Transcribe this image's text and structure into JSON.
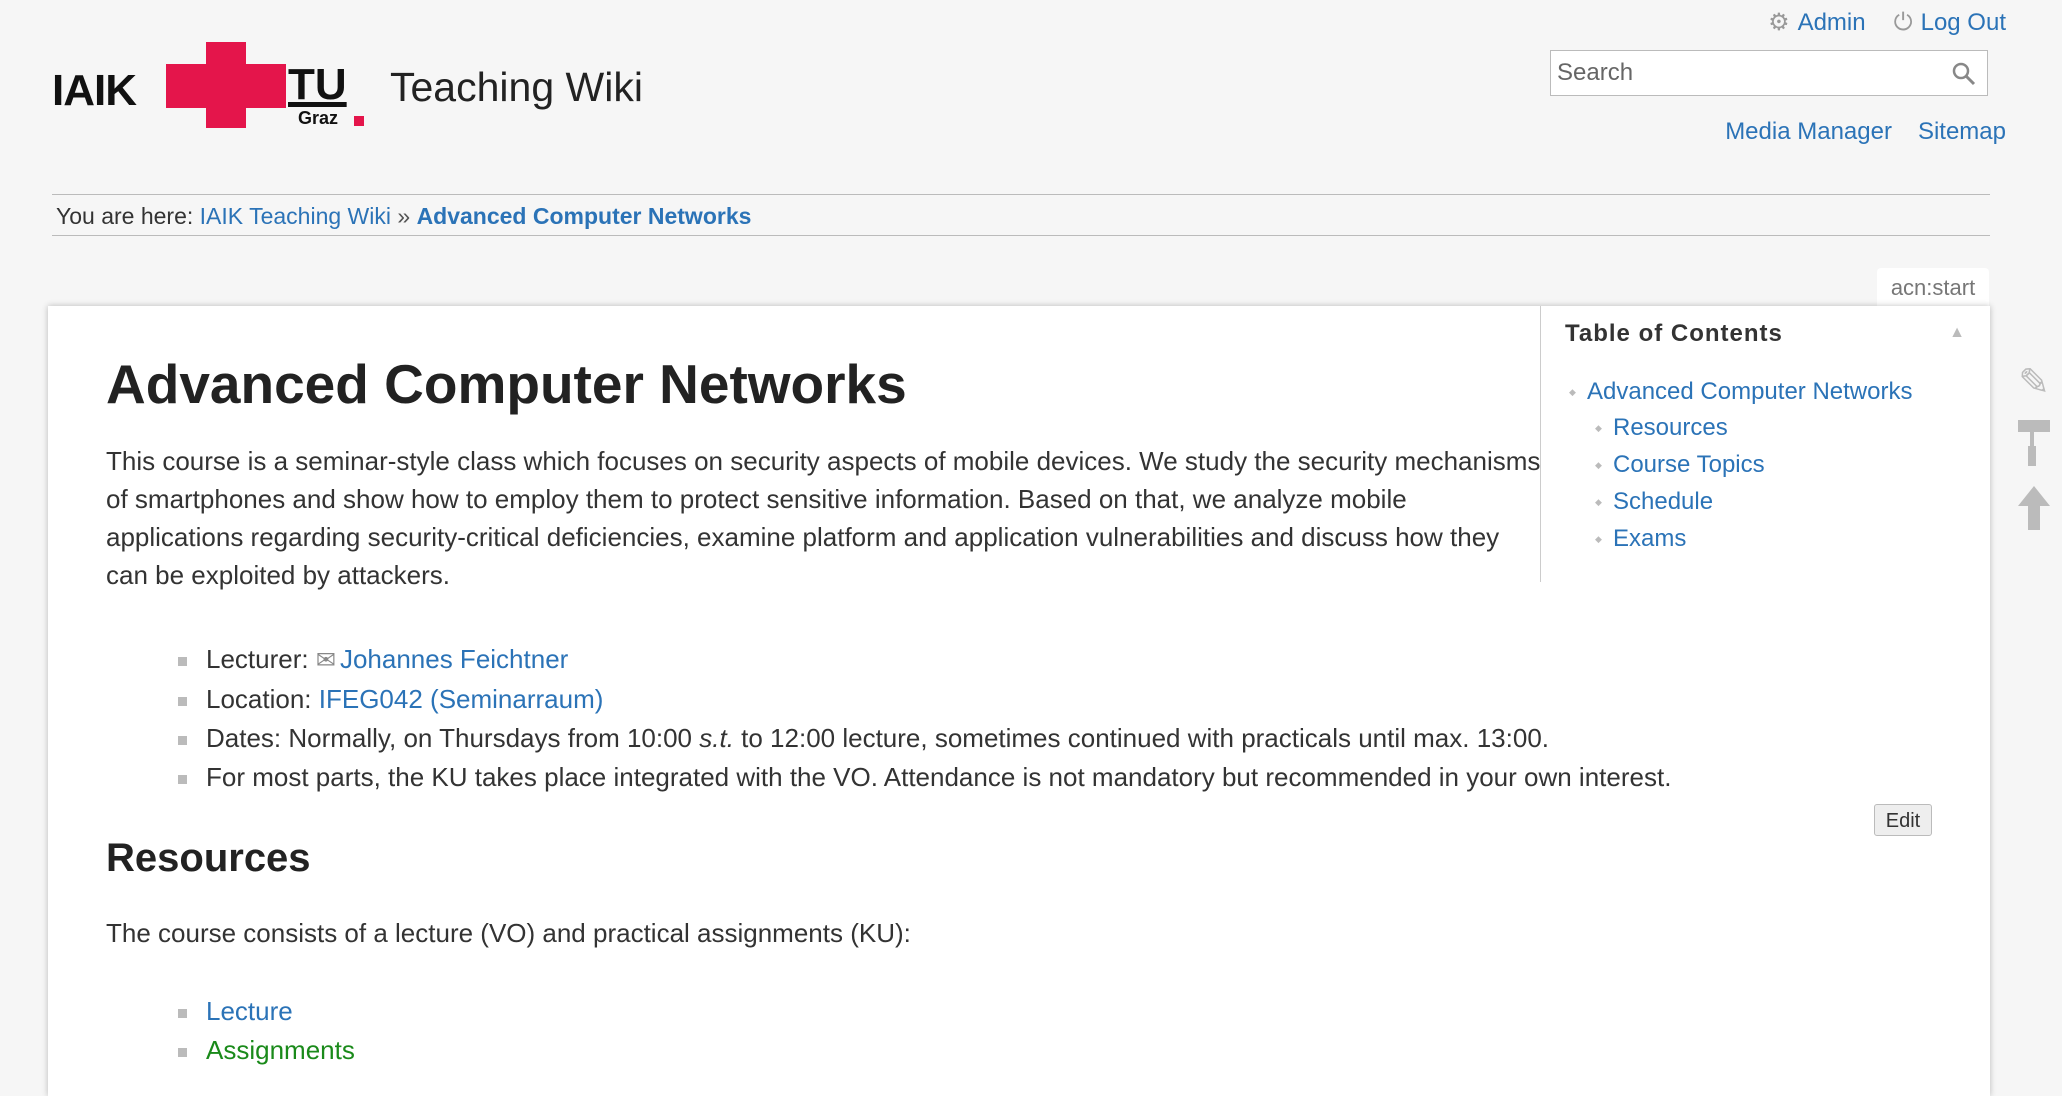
{
  "header": {
    "logo_text_iaik": "IAIK",
    "logo_text_tu": "TU",
    "logo_text_graz": "Graz",
    "site_title": "Teaching Wiki",
    "brand_color": "#e4154b"
  },
  "user_tools": {
    "admin_label": "Admin",
    "admin_icon": "gear-icon",
    "logout_label": "Log Out",
    "logout_icon": "power-icon"
  },
  "search": {
    "placeholder": "Search",
    "value": "",
    "icon": "search-icon"
  },
  "site_tools": {
    "media_manager_label": "Media Manager",
    "sitemap_label": "Sitemap"
  },
  "breadcrumb": {
    "prefix": "You are here:",
    "items": [
      "IAIK Teaching Wiki",
      "Advanced Computer Networks"
    ],
    "separator": "»"
  },
  "page_id": "acn:start",
  "page": {
    "title": "Advanced Computer Networks",
    "intro": "This course is a seminar-style class which focuses on security aspects of mobile devices. We study the security mechanisms of smartphones and show how to employ them to protect sensitive information. Based on that, we analyze mobile applications regarding security-critical deficiencies, examine platform and application vulnerabilities and discuss how they can be exploited by attackers.",
    "info": {
      "lecturer_label": "Lecturer:",
      "lecturer_name": "Johannes Feichtner",
      "location_label": "Location:",
      "location_link": "IFEG042 (Seminarraum)",
      "dates_prefix": "Dates: Normally, on Thursdays from 10:00 ",
      "dates_st": "s.t.",
      "dates_suffix": " to 12:00 lecture, sometimes continued with practicals until max. 13:00.",
      "ku_note": "For most parts, the KU takes place integrated with the VO. Attendance is not mandatory but recommended in your own interest."
    },
    "edit_label": "Edit",
    "resources_heading": "Resources",
    "resources_intro": "The course consists of a lecture (VO) and practical assignments (KU):",
    "resources": [
      "Lecture",
      "Assignments"
    ]
  },
  "toc": {
    "title": "Table of Contents",
    "items": [
      "Advanced Computer Networks",
      "Resources",
      "Course Topics",
      "Schedule",
      "Exams"
    ]
  },
  "page_tools": [
    "pencil-icon",
    "paint-roller-icon",
    "arrow-up-icon"
  ]
}
